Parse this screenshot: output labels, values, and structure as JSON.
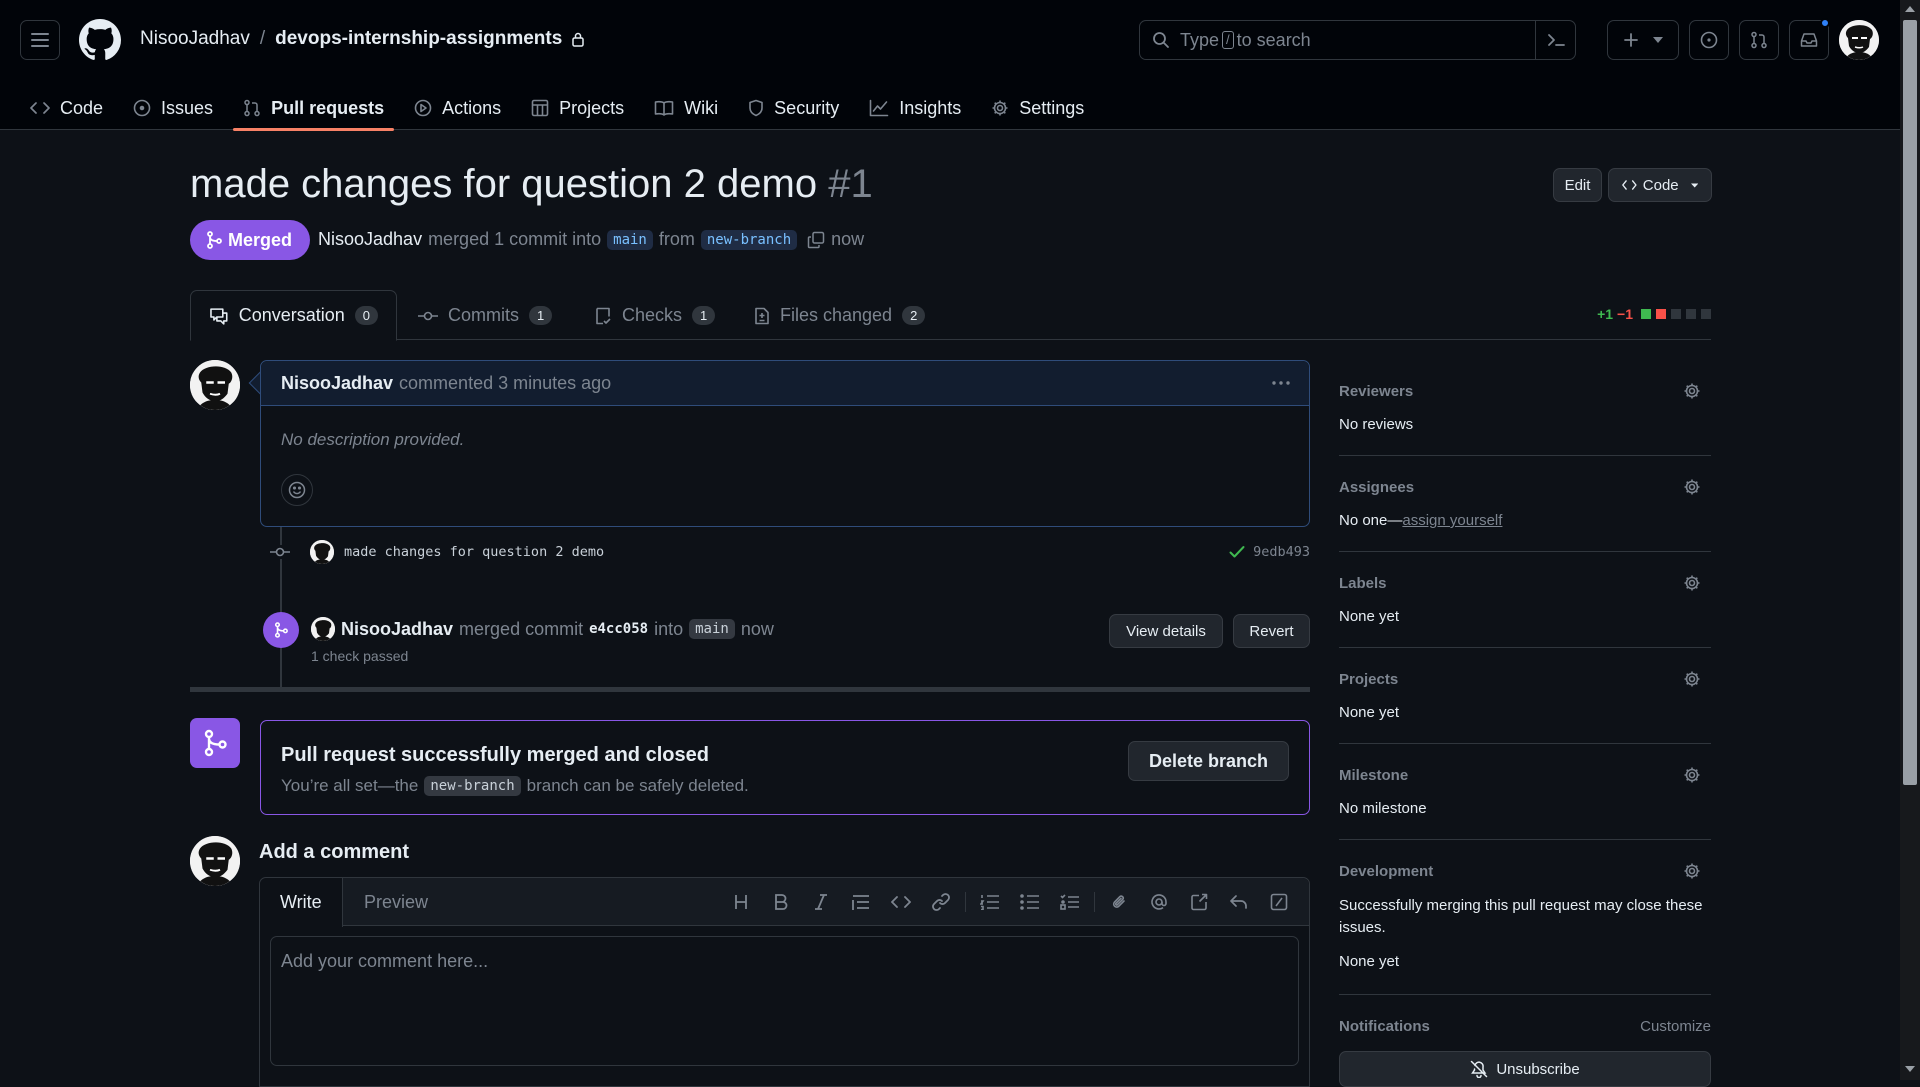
{
  "header": {
    "owner": "NisooJadhav",
    "separator": "/",
    "repo": "devops-internship-assignments",
    "search_prefix": "Type",
    "search_key": "/",
    "search_suffix": "to search"
  },
  "nav": {
    "code": "Code",
    "issues": "Issues",
    "pull_requests": "Pull requests",
    "actions": "Actions",
    "projects": "Projects",
    "wiki": "Wiki",
    "security": "Security",
    "insights": "Insights",
    "settings": "Settings"
  },
  "pr": {
    "title": "made changes for question 2 demo",
    "number": "#1",
    "edit_label": "Edit",
    "code_label": "Code",
    "state": "Merged",
    "author": "NisooJadhav",
    "merged_text": "merged 1 commit into",
    "base": "main",
    "from_text": "from",
    "head": "new-branch",
    "time": "now"
  },
  "tabs": {
    "conversation": "Conversation",
    "conversation_count": "0",
    "commits": "Commits",
    "commits_count": "1",
    "checks": "Checks",
    "checks_count": "1",
    "files": "Files changed",
    "files_count": "2",
    "additions": "+1",
    "deletions": "−1"
  },
  "comment": {
    "author": "NisooJadhav",
    "action": "commented 3 minutes ago",
    "body": "No description provided."
  },
  "commit": {
    "message": "made changes for question 2 demo",
    "sha": "9edb493"
  },
  "merge_event": {
    "author": "NisooJadhav",
    "text1": "merged commit",
    "sha": "e4cc058",
    "text2": "into",
    "branch": "main",
    "time": "now",
    "checks": "1 check passed",
    "view_details": "View details",
    "revert": "Revert"
  },
  "merged_box": {
    "title": "Pull request successfully merged and closed",
    "text_before": "You’re all set—the",
    "branch": "new-branch",
    "text_after": "branch can be safely deleted.",
    "delete_label": "Delete branch"
  },
  "add_comment": {
    "title": "Add a comment",
    "write_tab": "Write",
    "preview_tab": "Preview",
    "placeholder": "Add your comment here..."
  },
  "sidebar": {
    "reviewers_title": "Reviewers",
    "reviewers_value": "No reviews",
    "assignees_title": "Assignees",
    "assignees_value": "No one—",
    "assign_link": "assign yourself",
    "labels_title": "Labels",
    "labels_value": "None yet",
    "projects_title": "Projects",
    "projects_value": "None yet",
    "milestone_title": "Milestone",
    "milestone_value": "No milestone",
    "development_title": "Development",
    "development_desc": "Successfully merging this pull request may close these issues.",
    "development_value": "None yet",
    "notifications_title": "Notifications",
    "customize": "Customize",
    "unsubscribe": "Unsubscribe"
  },
  "colors": {
    "merged": "#8957e5",
    "accent_tab": "#f78166",
    "addition": "#3fb950",
    "deletion": "#f85149",
    "link": "#2f81f7"
  },
  "icons": [
    "hamburger-icon",
    "github-logo-icon",
    "lock-icon",
    "search-icon",
    "command-palette-icon",
    "plus-icon",
    "issues-icon",
    "pull-request-icon",
    "inbox-icon",
    "code-icon",
    "play-icon",
    "table-icon",
    "book-icon",
    "shield-icon",
    "graph-icon",
    "gear-icon",
    "merge-icon",
    "copy-icon",
    "comment-icon",
    "commit-icon",
    "checklist-icon",
    "file-diff-icon",
    "kebab-icon",
    "smiley-icon",
    "check-icon",
    "bell-slash-icon"
  ]
}
